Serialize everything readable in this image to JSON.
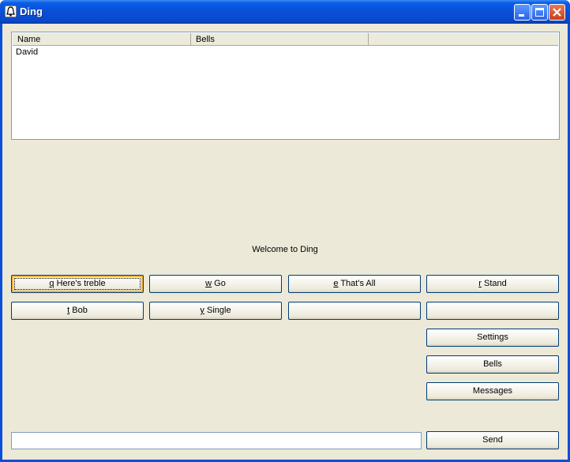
{
  "window": {
    "title": "Ding"
  },
  "listview": {
    "columns": [
      "Name",
      "Bells",
      ""
    ],
    "rows": [
      {
        "name": "David",
        "bells": ""
      }
    ]
  },
  "status": {
    "welcome": "Welcome to Ding"
  },
  "buttons": {
    "row1": [
      {
        "key": "q",
        "label": " Here's treble"
      },
      {
        "key": "w",
        "label": " Go"
      },
      {
        "key": "e",
        "label": " That's All"
      },
      {
        "key": "r",
        "label": " Stand"
      }
    ],
    "row2": [
      {
        "key": "t",
        "label": " Bob"
      },
      {
        "key": "y",
        "label": " Single"
      },
      {
        "key": "",
        "label": ""
      },
      {
        "key": "",
        "label": ""
      }
    ],
    "settings": "Settings",
    "bells": "Bells",
    "messages": "Messages",
    "send": "Send"
  },
  "message_input": {
    "value": ""
  }
}
